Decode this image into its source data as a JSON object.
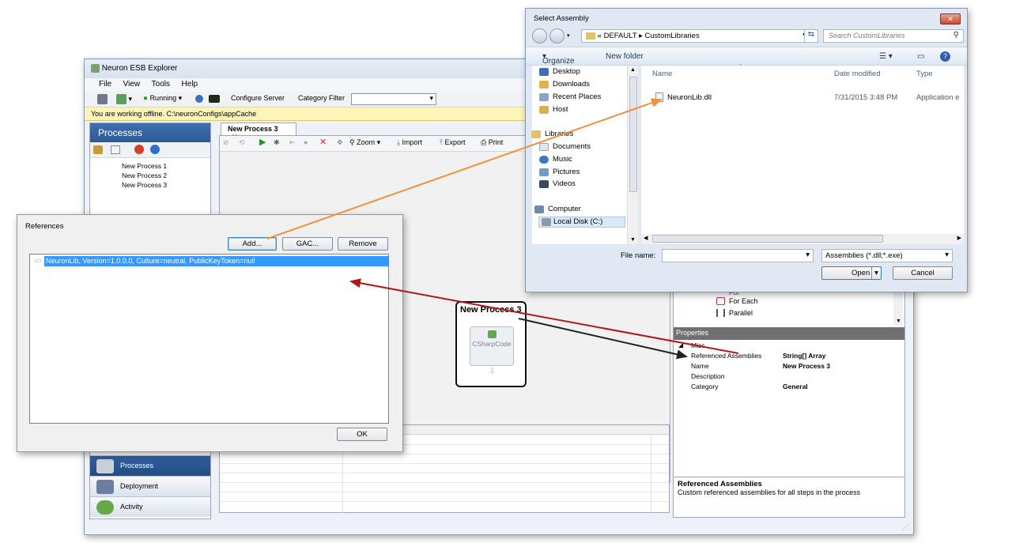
{
  "main": {
    "title": "Neuron ESB Explorer",
    "menu": [
      "File",
      "View",
      "Tools",
      "Help"
    ],
    "toolbar": {
      "running": "Running",
      "configure_server": "Configure Server",
      "category_filter": "Category Filter"
    },
    "offline_message": "You are working offline. C:\\neuronConfigs\\appCache",
    "processes_header": "Processes",
    "processes": [
      "New Process 1",
      "New Process 2",
      "New Process 3"
    ],
    "nav_buttons": [
      "Processes",
      "Deployment",
      "Activity"
    ],
    "tab_label": "New Process 3",
    "designer_toolbar": {
      "zoom": "Zoom",
      "import": "Import",
      "export": "Export",
      "print": "Print"
    },
    "process_box": {
      "title": "New Process 3",
      "step_label": "CSharpCode"
    },
    "toolbox_items": [
      "For",
      "For Each",
      "Parallel"
    ],
    "properties": {
      "header": "Properties",
      "category": "Misc",
      "rows": [
        {
          "key": "Referenced Assemblies",
          "value": "String[] Array"
        },
        {
          "key": "Name",
          "value": "New Process 3"
        },
        {
          "key": "Description",
          "value": ""
        },
        {
          "key": "Category",
          "value": "General"
        }
      ]
    },
    "description": {
      "title": "Referenced Assemblies",
      "text": "Custom referenced assemblies for all steps in the process"
    }
  },
  "references_dialog": {
    "title": "References",
    "buttons": {
      "add": "Add...",
      "gac": "GAC...",
      "remove": "Remove",
      "ok": "OK"
    },
    "item": "NeuronLib, Version=1.0.0.0, Culture=neutral, PublicKeyToken=null"
  },
  "select_dialog": {
    "title": "Select Assembly",
    "close_glyph": "✕",
    "breadcrumb": {
      "prefix": "«",
      "parts": [
        "DEFAULT",
        "CustomLibraries"
      ]
    },
    "search_placeholder": "Search CustomLibraries",
    "commands": {
      "organize": "Organize",
      "new_folder": "New folder"
    },
    "nav": {
      "favorites": [
        "Desktop",
        "Downloads",
        "Recent Places",
        "Host"
      ],
      "libraries_header": "Libraries",
      "libraries": [
        "Documents",
        "Music",
        "Pictures",
        "Videos"
      ],
      "computer_header": "Computer",
      "computer": [
        "Local Disk (C:)"
      ]
    },
    "columns": [
      "Name",
      "Date modified",
      "Type"
    ],
    "files": [
      {
        "name": "NeuronLib.dll",
        "date": "7/31/2015 3:48 PM",
        "type": "Application e"
      }
    ],
    "file_name_label": "File name:",
    "file_name_value": "",
    "filter": "Assemblies (*.dll;*.exe)",
    "buttons": {
      "open": "Open",
      "cancel": "Cancel"
    }
  },
  "colors": {
    "selection": "#3399ff",
    "nav_header": "#2c5a97",
    "offline_bar": "#fdf4b8",
    "arrow_orange": "#f0913c",
    "arrow_red": "#b01818",
    "arrow_dark": "#222222"
  }
}
